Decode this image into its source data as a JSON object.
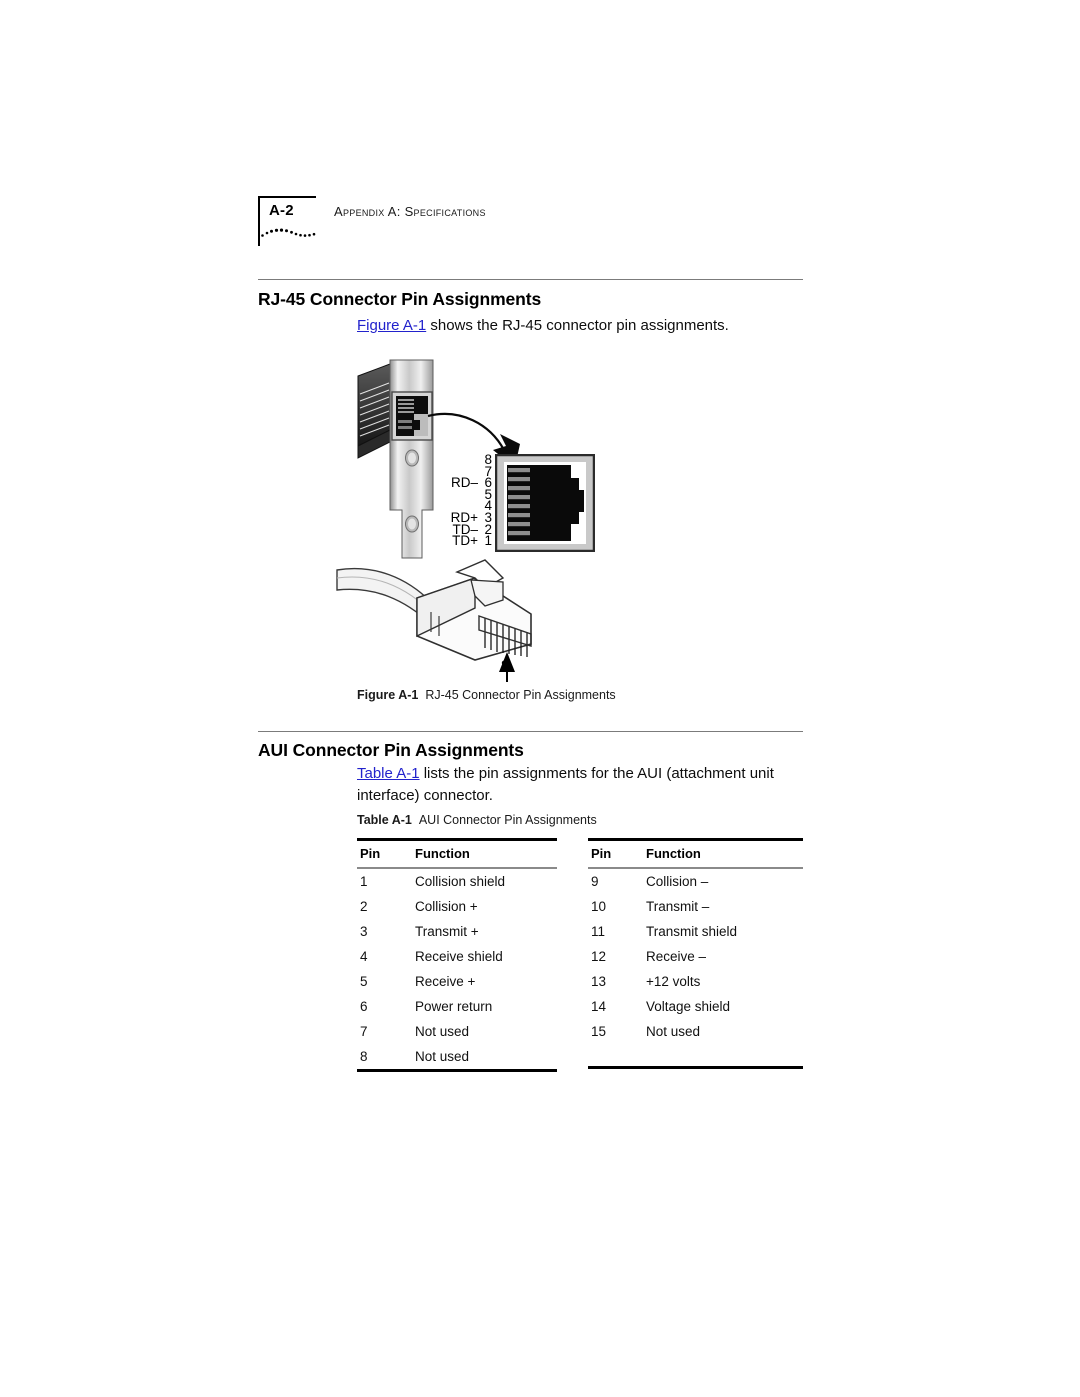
{
  "page": {
    "number": "A-2",
    "running_head": "Appendix A: Specifications"
  },
  "sections": [
    {
      "heading": "RJ-45 Connector Pin Assignments",
      "intro_link": "Figure A-1",
      "intro_rest": " shows the RJ-45 connector pin assignments."
    },
    {
      "heading": "AUI Connector Pin Assignments",
      "intro_link": "Table A-1",
      "intro_rest": " lists the pin assignments for the AUI (attachment unit interface) connector."
    }
  ],
  "figure": {
    "caption_label": "Figure A-1",
    "caption_text": "RJ-45 Connector Pin Assignments",
    "jack_pins": [
      {
        "signal": "",
        "pin": "8"
      },
      {
        "signal": "",
        "pin": "7"
      },
      {
        "signal": "RD–",
        "pin": "6"
      },
      {
        "signal": "",
        "pin": "5"
      },
      {
        "signal": "",
        "pin": "4"
      },
      {
        "signal": "RD+",
        "pin": "3"
      },
      {
        "signal": "TD–",
        "pin": "2"
      },
      {
        "signal": "TD+",
        "pin": "1"
      }
    ],
    "plug_callout": "8"
  },
  "table": {
    "label": "Table A-1",
    "title": "AUI Connector Pin Assignments",
    "columns": [
      "Pin",
      "Function"
    ],
    "left_rows": [
      [
        "1",
        "Collision shield"
      ],
      [
        "2",
        "Collision +"
      ],
      [
        "3",
        "Transmit +"
      ],
      [
        "4",
        "Receive shield"
      ],
      [
        "5",
        "Receive +"
      ],
      [
        "6",
        "Power return"
      ],
      [
        "7",
        "Not used"
      ],
      [
        "8",
        "Not used"
      ]
    ],
    "right_rows": [
      [
        "9",
        "Collision –"
      ],
      [
        "10",
        "Transmit –"
      ],
      [
        "11",
        "Transmit shield"
      ],
      [
        "12",
        "Receive –"
      ],
      [
        "13",
        "+12 volts"
      ],
      [
        "14",
        "Voltage shield"
      ],
      [
        "15",
        "Not used"
      ]
    ]
  },
  "colors": {
    "link": "#2222cc",
    "rule_thin": "#7b7b7b",
    "rule_thick": "#000000"
  }
}
